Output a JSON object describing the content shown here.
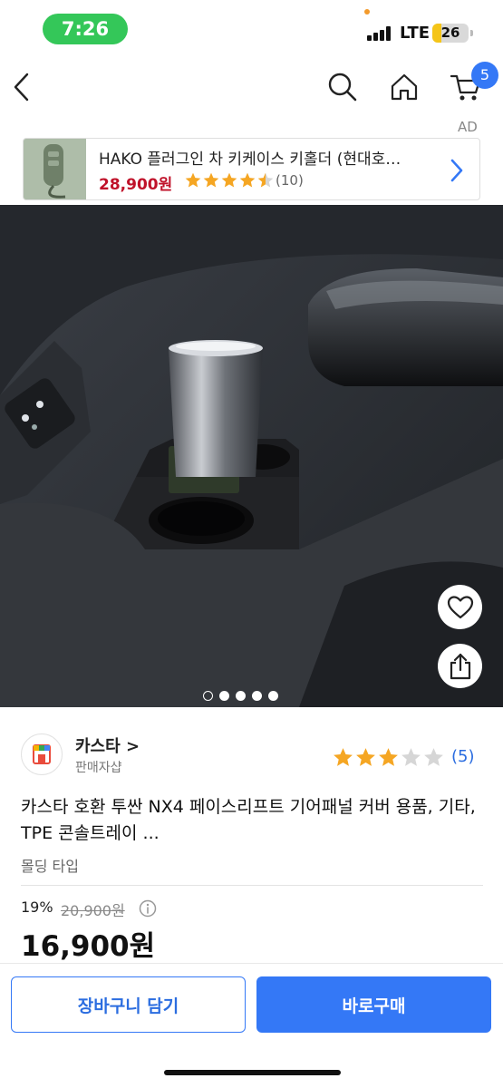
{
  "status_bar": {
    "time": "7:26",
    "network": "LTE",
    "battery": "26",
    "battery_level": 0.26,
    "colors": {
      "time_pill": "#34c759",
      "battery_low": "#f5c518"
    }
  },
  "nav": {
    "back_icon": "chevron-left-icon",
    "search_icon": "search-icon",
    "home_icon": "home-icon",
    "cart_icon": "cart-icon",
    "cart_count": "5"
  },
  "ad": {
    "label": "AD",
    "title": "HAKO 플러그인 차 키케이스 키홀더 (현대호…",
    "price": "28,900원",
    "rating": 4.5,
    "review_count": "(10)",
    "thumbnail_icon": "car-key-case-image"
  },
  "product_image": {
    "description_icon": "console-tray-photo",
    "pages": 5,
    "current_page": 1,
    "like_icon": "heart-icon",
    "share_icon": "share-icon"
  },
  "seller": {
    "name": "카스타 >",
    "type": "판매자샵",
    "rating": 3,
    "max_rating": 5,
    "review_count": "(5)"
  },
  "product": {
    "title": "카스타 호환 투싼 NX4 페이스리프트 기어패널 커버 용품, 기타, TPE 콘솔트레이 ...",
    "option_type": "몰딩 타입",
    "discount": "19%",
    "original_price": "20,900원",
    "price": "16,900원"
  },
  "actions": {
    "add_to_cart": "장바구니 담기",
    "buy_now": "바로구매"
  },
  "colors": {
    "accent": "#3478f6",
    "ad_price": "#c0122a",
    "star": "#f5a623"
  }
}
